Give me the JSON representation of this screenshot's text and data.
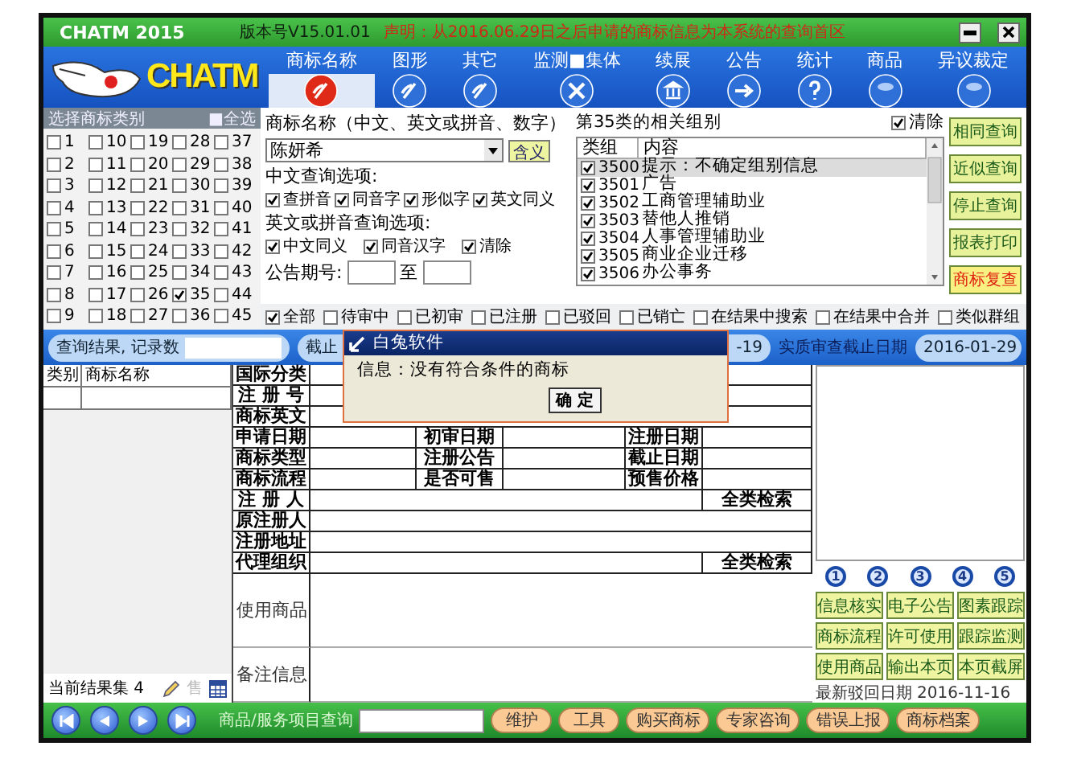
{
  "title_bar": {
    "app": "CHATM 2015",
    "version": "版本号V15.01.01",
    "notice": "声明：从2016.06.29日之后申请的商标信息为本系统的查询首区"
  },
  "logo": "CHATM",
  "tabs": [
    {
      "label": "商标名称",
      "kind": "pen",
      "selected": true
    },
    {
      "label": "图形",
      "kind": "pen",
      "selected": false
    },
    {
      "label": "其它",
      "kind": "pen",
      "selected": false
    },
    {
      "label": "监测■集体",
      "kind": "tools",
      "selected": false
    },
    {
      "label": "续展",
      "kind": "bank",
      "selected": false
    },
    {
      "label": "公告",
      "kind": "arrow",
      "selected": false
    },
    {
      "label": "统计",
      "kind": "help",
      "selected": false
    },
    {
      "label": "商品",
      "kind": "orb",
      "selected": false
    },
    {
      "label": "异议裁定",
      "kind": "orb",
      "selected": false
    }
  ],
  "class_panel": {
    "title": "选择商标类别",
    "select_all": "■全选",
    "classes": [
      {
        "label": "1",
        "checked": false
      },
      {
        "label": "2",
        "checked": false
      },
      {
        "label": "3",
        "checked": false
      },
      {
        "label": "4",
        "checked": false
      },
      {
        "label": "5",
        "checked": false
      },
      {
        "label": "6",
        "checked": false
      },
      {
        "label": "7",
        "checked": false
      },
      {
        "label": "8",
        "checked": false
      },
      {
        "label": "9",
        "checked": false
      },
      {
        "label": "10",
        "checked": false
      },
      {
        "label": "11",
        "checked": false
      },
      {
        "label": "12",
        "checked": false
      },
      {
        "label": "13",
        "checked": false
      },
      {
        "label": "14",
        "checked": false
      },
      {
        "label": "15",
        "checked": false
      },
      {
        "label": "16",
        "checked": false
      },
      {
        "label": "17",
        "checked": false
      },
      {
        "label": "18",
        "checked": false
      },
      {
        "label": "19",
        "checked": false
      },
      {
        "label": "20",
        "checked": false
      },
      {
        "label": "21",
        "checked": false
      },
      {
        "label": "22",
        "checked": false
      },
      {
        "label": "23",
        "checked": false
      },
      {
        "label": "24",
        "checked": false
      },
      {
        "label": "25",
        "checked": false
      },
      {
        "label": "26",
        "checked": false
      },
      {
        "label": "27",
        "checked": false
      },
      {
        "label": "28",
        "checked": false
      },
      {
        "label": "29",
        "checked": false
      },
      {
        "label": "30",
        "checked": false
      },
      {
        "label": "31",
        "checked": false
      },
      {
        "label": "32",
        "checked": false
      },
      {
        "label": "33",
        "checked": false
      },
      {
        "label": "34",
        "checked": false
      },
      {
        "label": "35",
        "checked": true
      },
      {
        "label": "36",
        "checked": false
      },
      {
        "label": "37",
        "checked": false
      },
      {
        "label": "38",
        "checked": false
      },
      {
        "label": "39",
        "checked": false
      },
      {
        "label": "40",
        "checked": false
      },
      {
        "label": "41",
        "checked": false
      },
      {
        "label": "42",
        "checked": false
      },
      {
        "label": "43",
        "checked": false
      },
      {
        "label": "44",
        "checked": false
      },
      {
        "label": "45",
        "checked": false
      }
    ]
  },
  "search_form": {
    "title": "商标名称（中文、英文或拼音、数字）",
    "name_value": "陈妍希",
    "meaning_button": "含义",
    "cn_options_label": "中文查询选项:",
    "cn_options": [
      {
        "label": "查拼音",
        "checked": true
      },
      {
        "label": "同音字",
        "checked": true
      },
      {
        "label": "形似字",
        "checked": true
      },
      {
        "label": "英文同义",
        "checked": true
      }
    ],
    "en_options_label": "英文或拼音查询选项:",
    "en_options": [
      {
        "label": "中文同义",
        "checked": true
      },
      {
        "label": "同音汉字",
        "checked": true
      },
      {
        "label": "清除",
        "checked": true
      }
    ],
    "issue_label": "公告期号:",
    "issue_to": "至"
  },
  "groups": {
    "title": "第35类的相关组别",
    "clear": {
      "label": "清除",
      "checked": true
    },
    "columns": [
      "类组",
      "内容"
    ],
    "rows": [
      {
        "code": "3500",
        "content": "提示：不确定组别信息",
        "checked": true,
        "selected": true
      },
      {
        "code": "3501",
        "content": "广告",
        "checked": true,
        "selected": false
      },
      {
        "code": "3502",
        "content": "工商管理辅助业",
        "checked": true,
        "selected": false
      },
      {
        "code": "3503",
        "content": "替他人推销",
        "checked": true,
        "selected": false
      },
      {
        "code": "3504",
        "content": "人事管理辅助业",
        "checked": true,
        "selected": false
      },
      {
        "code": "3505",
        "content": "商业企业迁移",
        "checked": true,
        "selected": false
      },
      {
        "code": "3506",
        "content": "办公事务",
        "checked": true,
        "selected": false
      }
    ]
  },
  "query_buttons": [
    {
      "label": "相同查询",
      "kind": "normal"
    },
    {
      "label": "近似查询",
      "kind": "normal"
    },
    {
      "label": "停止查询",
      "kind": "normal"
    },
    {
      "label": "报表打印",
      "kind": "normal"
    },
    {
      "label": "商标复查",
      "kind": "alert"
    }
  ],
  "status_filters": [
    {
      "label": "全部",
      "checked": true
    },
    {
      "label": "待审中",
      "checked": false
    },
    {
      "label": "已初审",
      "checked": false
    },
    {
      "label": "已注册",
      "checked": false
    },
    {
      "label": "已驳回",
      "checked": false
    },
    {
      "label": "已销亡",
      "checked": false
    },
    {
      "label": "在结果中搜索",
      "checked": false
    },
    {
      "label": "在结果中合并",
      "checked": false
    },
    {
      "label": "类似群组",
      "checked": false
    }
  ],
  "result_bar": {
    "count_label": "查询结果, 记录数",
    "deadline_label": "截止",
    "date_tail": "-19",
    "exam_label": "实质审查截止日期",
    "exam_date": "2016-01-29"
  },
  "result_list": {
    "columns": [
      "类别",
      "商标名称"
    ],
    "footer": "当前结果集 4",
    "sale_mark": "售"
  },
  "detail": {
    "top_rows": [
      "国际分类",
      "注 册 号",
      "商标英文"
    ],
    "date_rows": [
      [
        "申请日期",
        "初审日期",
        "注册日期"
      ],
      [
        "商标类型",
        "注册公告",
        "截止日期"
      ],
      [
        "商标流程",
        "是否可售",
        "预售价格"
      ]
    ],
    "party_rows": [
      {
        "label": "注 册 人",
        "action": "全类检索"
      },
      {
        "label": "原注册人"
      },
      {
        "label": "注册地址"
      },
      {
        "label": "代理组织",
        "action": "全类检索"
      }
    ],
    "goods_label": "使用商品",
    "notes_label": "备注信息"
  },
  "steps": [
    "1",
    "2",
    "3",
    "4",
    "5"
  ],
  "action_buttons": [
    "信息核实",
    "电子公告",
    "图素跟踪",
    "商标流程",
    "许可使用",
    "跟踪监测",
    "使用商品",
    "输出本页",
    "本页截屏"
  ],
  "latest_reject": {
    "label": "最新驳回日期",
    "date": "2016-11-16"
  },
  "bottom_bar": {
    "goods_query_label": "商品/服务项目查询",
    "buttons": [
      "维护",
      "工具",
      "购买商标",
      "专家咨询",
      "错误上报",
      "商标档案"
    ]
  },
  "dialog": {
    "title": "白兔软件",
    "message": "信息：没有符合条件的商标",
    "ok": "确 定"
  }
}
